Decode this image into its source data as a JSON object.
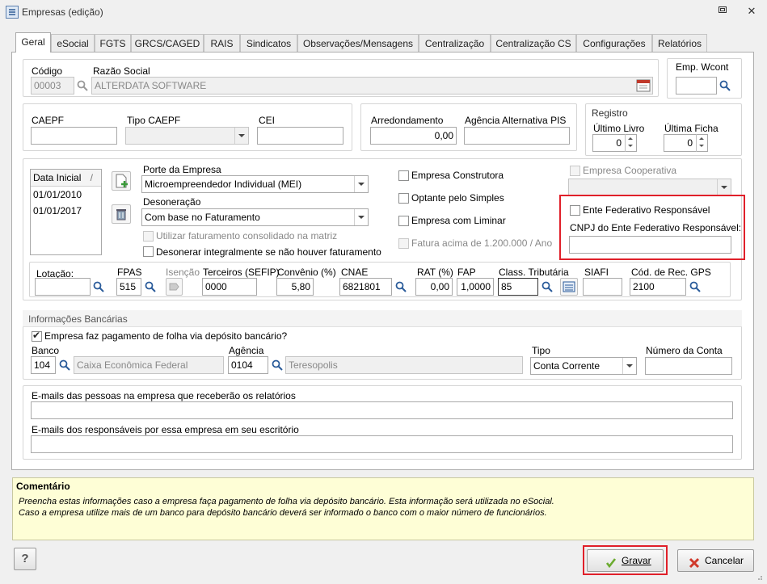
{
  "window": {
    "title": "Empresas (edição)"
  },
  "tabs": [
    "Geral",
    "eSocial",
    "FGTS",
    "GRCS/CAGED",
    "RAIS",
    "Sindicatos",
    "Observações/Mensagens",
    "Centralização",
    "Centralização CS",
    "Configurações",
    "Relatórios"
  ],
  "header": {
    "codigo_label": "Código",
    "codigo_value": "00003",
    "razao_label": "Razão Social",
    "razao_value": "ALTERDATA SOFTWARE",
    "wcont_label": "Emp. Wcont",
    "wcont_value": ""
  },
  "caepf": {
    "caepf_label": "CAEPF",
    "caepf_value": "",
    "tipo_label": "Tipo CAEPF",
    "tipo_value": "",
    "cei_label": "CEI",
    "cei_value": ""
  },
  "arredondamento": {
    "label": "Arredondamento",
    "value": "0,00",
    "agencia_label": "Agência Alternativa PIS",
    "agencia_value": ""
  },
  "registro": {
    "title": "Registro",
    "livro_label": "Último Livro",
    "livro_value": "0",
    "ficha_label": "Última Ficha",
    "ficha_value": "0"
  },
  "datas": {
    "header": "Data Inicial",
    "rows": [
      "01/01/2010",
      "01/01/2017"
    ]
  },
  "porte": {
    "label": "Porte da Empresa",
    "value": "Microempreendedor Individual (MEI)"
  },
  "desoneracao": {
    "label": "Desoneração",
    "value": "Com base no Faturamento",
    "consolidado": "Utilizar faturamento consolidado na matriz",
    "integral": "Desonerar integralmente se não houver faturamento"
  },
  "flags": {
    "construtora": "Empresa Construtora",
    "simples": "Optante pelo Simples",
    "liminar": "Empresa com Liminar",
    "fatura": "Fatura acima de 1.200.000 / Ano",
    "cooperativa": "Empresa Cooperativa",
    "ente": "Ente Federativo Responsável",
    "cnpj_ente": "CNPJ do Ente Federativo Responsável:"
  },
  "fiscal": {
    "lotacao_label": "Lotação:",
    "lotacao_value": "",
    "fpas_label": "FPAS",
    "fpas_value": "515",
    "isencao_label": "Isenção",
    "terceiros_label": "Terceiros (SEFIP)",
    "terceiros_value": "0000",
    "convenio_label": "Convênio (%)",
    "convenio_value": "5,80",
    "cnae_label": "CNAE",
    "cnae_value": "6821801",
    "rat_label": "RAT (%)",
    "rat_value": "0,00",
    "fap_label": "FAP",
    "fap_value": "1,0000",
    "class_label": "Class. Tributária",
    "class_value": "85",
    "siafi_label": "SIAFI",
    "siafi_value": "",
    "gps_label": "Cód. de Rec. GPS",
    "gps_value": "2100"
  },
  "banco": {
    "title": "Informações Bancárias",
    "pagamento": "Empresa faz pagamento de folha via depósito bancário?",
    "banco_label": "Banco",
    "banco_code": "104",
    "banco_name": "Caixa Econômica Federal",
    "agencia_label": "Agência",
    "agencia_code": "0104",
    "agencia_name": "Teresopolis",
    "tipo_label": "Tipo",
    "tipo_value": "Conta Corrente",
    "conta_label": "Número da Conta",
    "conta_value": ""
  },
  "emails": {
    "relatorios_label": "E-mails das pessoas na empresa que receberão os relatórios",
    "responsaveis_label": "E-mails dos responsáveis por essa empresa em seu escritório"
  },
  "comment": {
    "title": "Comentário",
    "line1": "Preencha estas informações caso a empresa faça pagamento de folha via depósito bancário. Esta informação será utilizada no eSocial.",
    "line2": "Caso a empresa utilize mais de um banco para depósito bancário deverá ser informado o banco com o maior número de funcionários."
  },
  "buttons": {
    "help": "?",
    "save": "Gravar",
    "cancel": "Cancelar"
  },
  "colors": {
    "highlight": "#e0202a",
    "comment_bg": "#fefed6"
  }
}
